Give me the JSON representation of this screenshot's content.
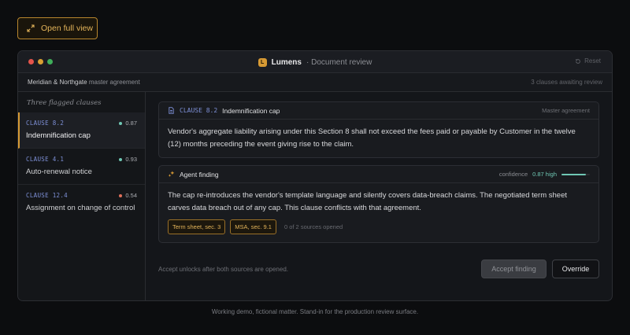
{
  "open_full_view": {
    "label": "Open full view",
    "icon": "expand-icon"
  },
  "window": {
    "app_initial": "L",
    "app_name": "Lumens",
    "app_subtitle": "· Document review",
    "reset_label": "Reset",
    "traffic_lights": [
      "#e5544b",
      "#d9a032",
      "#3fae5a"
    ]
  },
  "subbar": {
    "matter_name": "Meridian & Northgate",
    "matter_suffix": "master agreement",
    "awaiting": "3 clauses awaiting review"
  },
  "sidebar": {
    "heading": "Three flagged clauses",
    "items": [
      {
        "id": "CLAUSE 8.2",
        "score": "0.87",
        "score_color": "#6fc7b4",
        "title": "Indemnification cap",
        "active": true
      },
      {
        "id": "CLAUSE 4.1",
        "score": "0.93",
        "score_color": "#6fc7b4",
        "title": "Auto-renewal notice",
        "active": false
      },
      {
        "id": "CLAUSE 12.4",
        "score": "0.54",
        "score_color": "#e0705a",
        "title": "Assignment on change of control",
        "active": false
      }
    ]
  },
  "clause_card": {
    "clause_id": "CLAUSE 8.2",
    "clause_name": "Indemnification cap",
    "tag": "Master agreement",
    "text": "Vendor's aggregate liability arising under this Section 8 shall not exceed the fees paid or payable by Customer in the twelve (12) months preceding the event giving rise to the claim."
  },
  "finding_card": {
    "label": "Agent finding",
    "confidence_label": "confidence",
    "confidence_value": "0.87 high",
    "confidence_fraction": 0.87,
    "text": "The cap re-introduces the vendor's template language and silently covers data-breach claims. The negotiated term sheet carves data breach out of any cap. This clause conflicts with that agreement.",
    "sources": [
      "Term sheet, sec. 3",
      "MSA, sec. 9.1"
    ],
    "sources_count": "0 of 2 sources opened"
  },
  "footer": {
    "hint": "Accept unlocks after both sources are opened.",
    "accept_label": "Accept finding",
    "override_label": "Override"
  },
  "caption": "Working demo, fictional matter. Stand-in for the production review surface.",
  "colors": {
    "accent": "#d79a34",
    "clause_blue": "#7d8fd6",
    "confidence_teal": "#6fc7b4"
  }
}
